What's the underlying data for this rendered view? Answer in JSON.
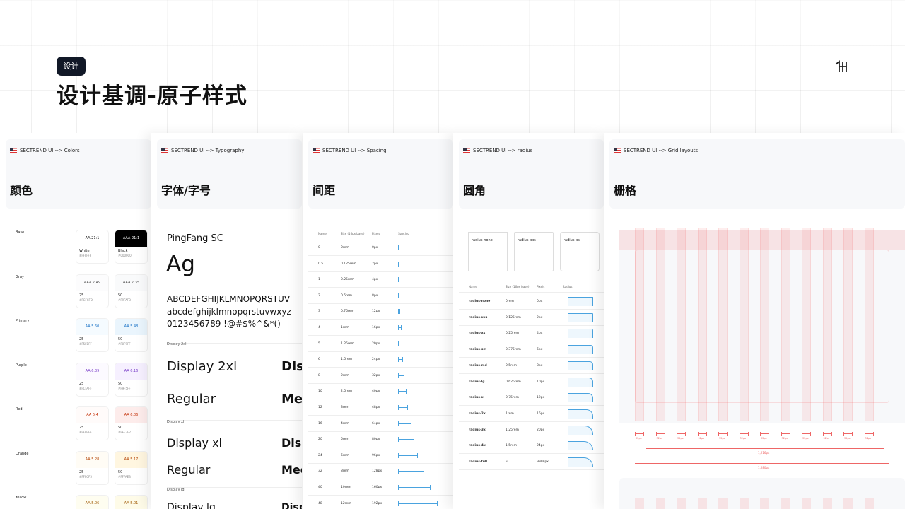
{
  "header": {
    "tag": "设计",
    "title": "设计基调-原子样式"
  },
  "panels": {
    "colors": {
      "crumb": "SECTREND UI --> Colors",
      "name": "颜色",
      "groups": [
        {
          "label": "Base",
          "a": {
            "aa": "AA 21:1",
            "n": "White",
            "hex": "#FFFFFF",
            "bg": "#ffffff",
            "fg": "#111111"
          },
          "b": {
            "aa": "AAA 21:1",
            "n": "Black",
            "hex": "#000000",
            "bg": "#000000",
            "fg": "#ffffff"
          }
        },
        {
          "label": "Gray",
          "a": {
            "aa": "AAA 7.49",
            "n": "25",
            "hex": "#FCFCFD",
            "bg": "#fcfcfd",
            "fg": "#444"
          },
          "b": {
            "aa": "AAA 7.35",
            "n": "50",
            "hex": "#F9FAFB",
            "bg": "#f9fafb",
            "fg": "#444"
          }
        },
        {
          "label": "Primary",
          "a": {
            "aa": "AA 5.60",
            "n": "25",
            "hex": "#F5FBFF",
            "bg": "#f5fbff",
            "fg": "#1d74c7"
          },
          "b": {
            "aa": "AA 5.48",
            "n": "50",
            "hex": "#F0F9FF",
            "bg": "#eaf5fd",
            "fg": "#1d74c7"
          }
        },
        {
          "label": "Purple",
          "a": {
            "aa": "AA 6.39",
            "n": "25",
            "hex": "#FCFAFF",
            "bg": "#fcfaff",
            "fg": "#7a3ec9"
          },
          "b": {
            "aa": "AA 6.16",
            "n": "50",
            "hex": "#F9F5FF",
            "bg": "#f6f0ff",
            "fg": "#7a3ec9"
          }
        },
        {
          "label": "Red",
          "a": {
            "aa": "AA 6.4",
            "n": "25",
            "hex": "#FFFBFA",
            "bg": "#fffbfa",
            "fg": "#c4320a"
          },
          "b": {
            "aa": "AA 6.06",
            "n": "50",
            "hex": "#FEF3F2",
            "bg": "#fdeceb",
            "fg": "#c4320a"
          }
        },
        {
          "label": "Orange",
          "a": {
            "aa": "AA 5.28",
            "n": "25",
            "hex": "#FFFCF5",
            "bg": "#fffcf5",
            "fg": "#b54708"
          },
          "b": {
            "aa": "AA 5.17",
            "n": "50",
            "hex": "#FFFAEB",
            "bg": "#fff6e0",
            "fg": "#b54708"
          }
        },
        {
          "label": "Yellow",
          "a": {
            "aa": "AA 5.06",
            "n": "",
            "hex": "",
            "bg": "#fefdf0",
            "fg": "#a15c07"
          },
          "b": {
            "aa": "AA 5.01",
            "n": "",
            "hex": "",
            "bg": "#fefbe8",
            "fg": "#a15c07"
          }
        }
      ]
    },
    "typography": {
      "crumb": "SECTREND UI --> Typography",
      "name": "字体/字号",
      "font": "PingFang SC",
      "sample": "Ag",
      "upper": "ABCDEFGHIJKLMNOPQRSTUV",
      "lower": "abcdefghijklmnopqrstuvwxyz",
      "digits": "0123456789 !@#$%^&*()",
      "s1": "Display 2xl",
      "d1": "Display 2xl",
      "d1b": "Dis",
      "r1": "Regular",
      "r1b": "Me",
      "s2": "Display xl",
      "d2": "Display xl",
      "d2b": "Disp",
      "r2": "Regular",
      "r2b": "Mec",
      "s3": "Display lg",
      "d3": "Display lg",
      "d3b": "Disp"
    },
    "spacing": {
      "crumb": "SECTREND UI --> Spacing",
      "name": "间距",
      "headers": [
        "Name",
        "Size (16px base)",
        "Pixels",
        "Spacing"
      ],
      "rows": [
        [
          "0",
          "0rem",
          "0px",
          0
        ],
        [
          "0.5",
          "0.125rem",
          "2px",
          2
        ],
        [
          "1",
          "0.25rem",
          "4px",
          4
        ],
        [
          "2",
          "0.5rem",
          "8px",
          8
        ],
        [
          "3",
          "0.75rem",
          "12px",
          12
        ],
        [
          "4",
          "1rem",
          "16px",
          16
        ],
        [
          "5",
          "1.25rem",
          "20px",
          20
        ],
        [
          "6",
          "1.5rem",
          "24px",
          24
        ],
        [
          "8",
          "2rem",
          "32px",
          32
        ],
        [
          "10",
          "2.5rem",
          "40px",
          40
        ],
        [
          "12",
          "3rem",
          "48px",
          48
        ],
        [
          "16",
          "4rem",
          "64px",
          64
        ],
        [
          "20",
          "5rem",
          "80px",
          80
        ],
        [
          "24",
          "6rem",
          "96px",
          96
        ],
        [
          "32",
          "8rem",
          "128px",
          128
        ],
        [
          "40",
          "10rem",
          "160px",
          160
        ],
        [
          "48",
          "12rem",
          "192px",
          192
        ]
      ]
    },
    "radius": {
      "crumb": "SECTREND UI --> radius",
      "name": "圆角",
      "cards": [
        "radius-none",
        "radius-xxs",
        "radius-xs"
      ],
      "headers": [
        "Name",
        "Size (16px base)",
        "Pixels",
        "Radius"
      ],
      "rows": [
        [
          "radius-none",
          "0rem",
          "0px",
          0
        ],
        [
          "radius-xxs",
          "0.125rem",
          "2px",
          2
        ],
        [
          "radius-xs",
          "0.25rem",
          "4px",
          4
        ],
        [
          "radius-sm",
          "0.375rem",
          "6px",
          6
        ],
        [
          "radius-md",
          "0.5rem",
          "8px",
          8
        ],
        [
          "radius-lg",
          "0.625rem",
          "10px",
          10
        ],
        [
          "radius-xl",
          "0.75rem",
          "12px",
          12
        ],
        [
          "radius-2xl",
          "1rem",
          "16px",
          16
        ],
        [
          "radius-3xl",
          "1.25rem",
          "20px",
          20
        ],
        [
          "radius-4xl",
          "1.5rem",
          "24px",
          24
        ],
        [
          "radius-full",
          "∞",
          "9999px",
          9999
        ]
      ]
    },
    "grid": {
      "crumb": "SECTREND UI --> Grid layouts",
      "name": "栅格",
      "col_label": "32px",
      "w1": "1,216px",
      "w2": "1,280px",
      "columns": 12
    }
  }
}
